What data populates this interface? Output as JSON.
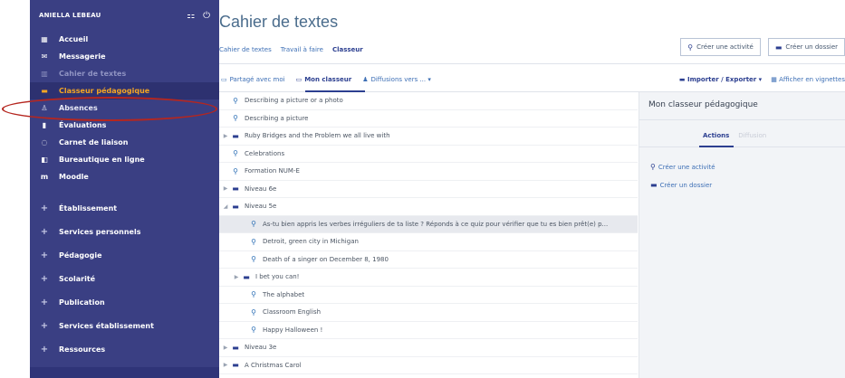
{
  "sidebar": {
    "user_name": "ANIELLA LEBEAU",
    "menu_icon": "⚏",
    "power_icon": "⏻",
    "items": [
      {
        "label": "Accueil",
        "icon": "▦",
        "state": "normal"
      },
      {
        "label": "Messagerie",
        "icon": "✉",
        "state": "normal"
      },
      {
        "label": "Cahier de textes",
        "icon": "▥",
        "state": "faded"
      },
      {
        "label": "Classeur pédagogique",
        "icon": "▬",
        "state": "active"
      },
      {
        "label": "Absences",
        "icon": "♙",
        "state": "dim"
      },
      {
        "label": "Évaluations",
        "icon": "▮",
        "state": "normal"
      },
      {
        "label": "Carnet de liaison",
        "icon": "◌",
        "state": "normal"
      },
      {
        "label": "Bureautique en ligne",
        "icon": "◧",
        "state": "normal"
      },
      {
        "label": "Moodle",
        "icon": "m",
        "state": "normal"
      }
    ],
    "sections": [
      {
        "label": "Établissement"
      },
      {
        "label": "Services personnels"
      },
      {
        "label": "Pédagogie"
      },
      {
        "label": "Scolarité"
      },
      {
        "label": "Publication"
      },
      {
        "label": "Services établissement"
      },
      {
        "label": "Ressources"
      }
    ]
  },
  "main": {
    "title": "Cahier de textes",
    "subtabs": [
      "Cahier de textes",
      "Travail à faire",
      "Classeur"
    ],
    "active_subtab": "Classeur",
    "create_activity": "Créer une activité",
    "create_folder": "Créer un dossier",
    "tabs": {
      "shared": "Partagé avec moi",
      "mine": "Mon classeur",
      "broadcasts": "Diffusions vers ... ▾"
    },
    "import_export": "Importer / Exporter ▾",
    "thumbnails": "Afficher en vignettes",
    "tree": [
      {
        "label": "Describing a picture or a photo",
        "type": "activity",
        "level": 0,
        "caret": ""
      },
      {
        "label": "Describing a picture",
        "type": "activity",
        "level": 0,
        "caret": ""
      },
      {
        "label": "Ruby Bridges and the Problem we all live with",
        "type": "folder",
        "level": 0,
        "caret": "▶"
      },
      {
        "label": "Celebrations",
        "type": "activity",
        "level": 0,
        "caret": ""
      },
      {
        "label": "Formation NUM-E",
        "type": "activity",
        "level": 0,
        "caret": ""
      },
      {
        "label": "Niveau 6e",
        "type": "folder",
        "level": 0,
        "caret": "▶"
      },
      {
        "label": "Niveau 5e",
        "type": "folder",
        "level": 0,
        "caret": "◢"
      },
      {
        "label": "As-tu bien appris les verbes irréguliers de ta liste ? Réponds à ce quiz pour vérifier que tu es bien prêt(e) p...",
        "type": "activity",
        "level": 1,
        "caret": "",
        "highlight": true
      },
      {
        "label": "Detroit, green city in Michigan",
        "type": "activity",
        "level": 1,
        "caret": ""
      },
      {
        "label": "Death of a singer on December 8, 1980",
        "type": "activity",
        "level": 1,
        "caret": ""
      },
      {
        "label": "I bet you can!",
        "type": "folder",
        "level": 2,
        "caret": "▶"
      },
      {
        "label": "The alphabet",
        "type": "activity",
        "level": 1,
        "caret": ""
      },
      {
        "label": "Classroom English",
        "type": "activity",
        "level": 1,
        "caret": ""
      },
      {
        "label": "Happy Halloween !",
        "type": "activity",
        "level": 1,
        "caret": ""
      },
      {
        "label": "Niveau 3e",
        "type": "folder",
        "level": 0,
        "caret": "▶"
      },
      {
        "label": "A Christmas Carol",
        "type": "folder",
        "level": 0,
        "caret": "▶"
      }
    ]
  },
  "panel": {
    "title": "Mon classeur pédagogique",
    "tab_actions": "Actions",
    "tab_diffusion": "Diffusion",
    "action_activity": "Créer une activité",
    "action_folder": "Créer un dossier"
  },
  "colors": {
    "sidebar_bg": "#3a3f83",
    "active_item": "#f5a623",
    "link_blue": "#3d6fb5",
    "brand_dark": "#2c3f90",
    "annotation_red": "#b5261f"
  }
}
